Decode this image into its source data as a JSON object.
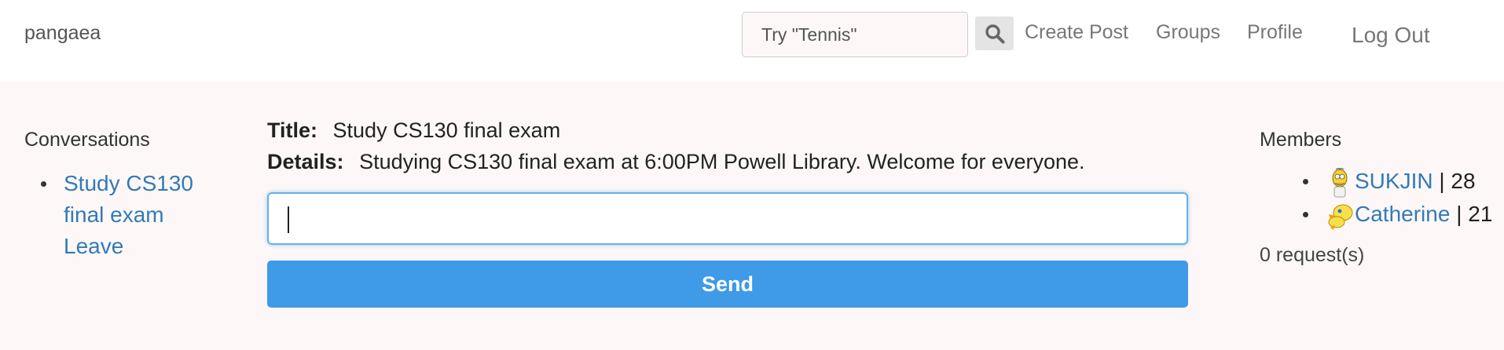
{
  "navbar": {
    "brand": "pangaea",
    "search_placeholder": "Try \"Tennis\"",
    "links": {
      "create_post": "Create Post",
      "groups": "Groups",
      "profile": "Profile",
      "log_out": "Log Out"
    }
  },
  "conversations": {
    "heading": "Conversations",
    "items": [
      {
        "label_line1": "Study CS130",
        "label_line2": "final exam"
      }
    ],
    "leave_label": "Leave"
  },
  "post": {
    "title_label": "Title:",
    "title_value": "Study CS130 final exam",
    "details_label": "Details:",
    "details_value": "Studying CS130 final exam at 6:00PM Powell Library. Welcome for everyone.",
    "message_value": "",
    "send_label": "Send"
  },
  "members": {
    "heading": "Members",
    "list": [
      {
        "name": "SUKJIN",
        "separator": "|",
        "age": "28",
        "avatar": "homer-avatar-icon"
      },
      {
        "name": "Catherine",
        "separator": "|",
        "age": "21",
        "avatar": "bird-avatar-icon"
      }
    ],
    "requests": "0 request(s)"
  },
  "colors": {
    "link": "#337ab7",
    "send_button": "#3f9ae8",
    "page_background": "#fdf8f7",
    "input_focus": "#66afe9"
  }
}
